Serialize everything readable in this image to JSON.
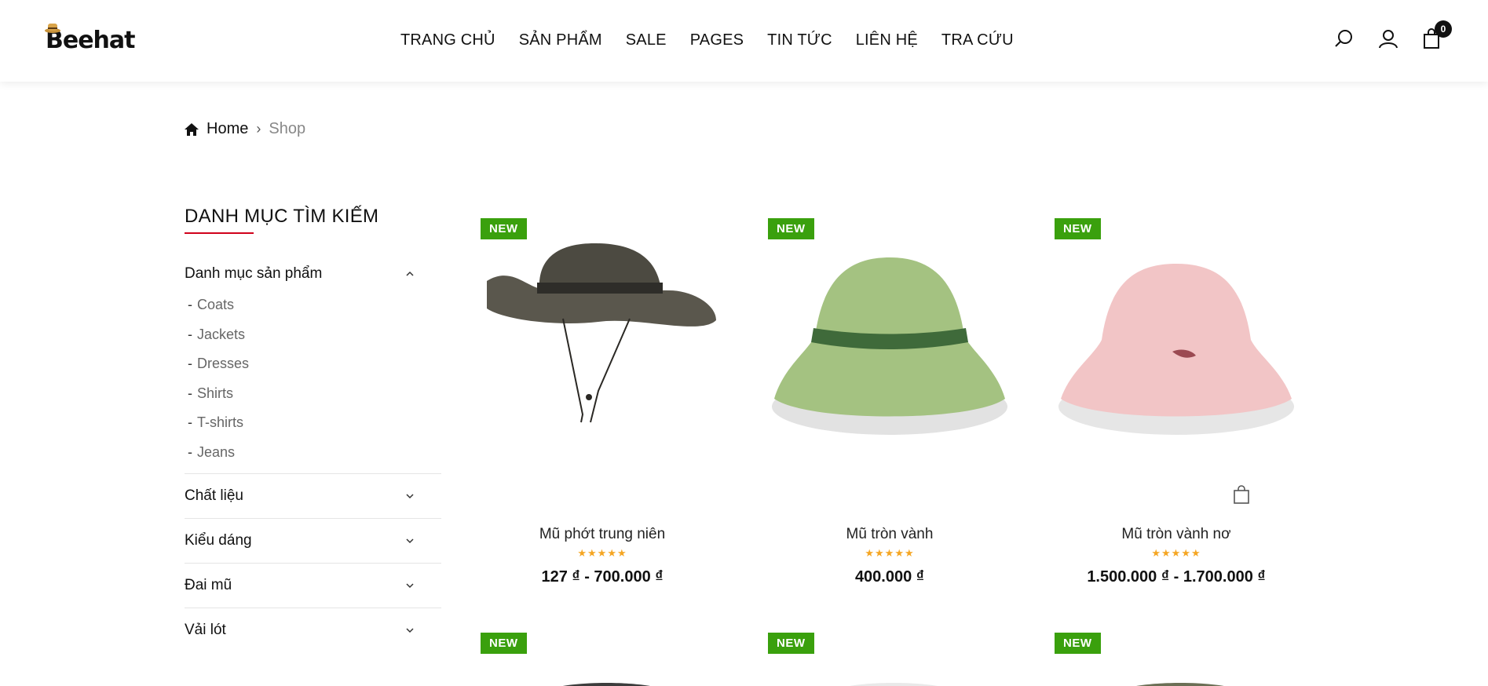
{
  "header": {
    "logo_text": "Beehat",
    "nav": [
      "TRANG CHỦ",
      "SẢN PHẨM",
      "SALE",
      "PAGES",
      "TIN TỨC",
      "LIÊN HỆ",
      "TRA CỨU"
    ],
    "cart_count": "0",
    "icons": [
      "search-icon",
      "user-icon",
      "shopping-bag-icon"
    ]
  },
  "breadcrumb": {
    "home": "Home",
    "current": "Shop"
  },
  "sidebar": {
    "title": "DANH MỤC TÌM KIẾM",
    "category_group": "Danh mục sản phẩm",
    "categories": [
      "Coats",
      "Jackets",
      "Dresses",
      "Shirts",
      "T-shirts",
      "Jeans"
    ],
    "groups": [
      "Chất liệu",
      "Kiểu dáng",
      "Đai mũ",
      "Vải lót"
    ]
  },
  "products": [
    {
      "badge": "NEW",
      "name": "Mũ phớt trung niên",
      "price": "127 ₫ - 700.000 ₫",
      "rating": 5
    },
    {
      "badge": "NEW",
      "name": "Mũ tròn vành",
      "price": "400.000 ₫",
      "rating": 5
    },
    {
      "badge": "NEW",
      "name": "Mũ tròn vành nơ",
      "price": "1.500.000 ₫ - 1.700.000 ₫",
      "rating": 5
    },
    {
      "badge": "NEW"
    },
    {
      "badge": "NEW"
    },
    {
      "badge": "NEW"
    }
  ],
  "colors": {
    "accent_red": "#d0021b",
    "badge_green": "#3aa00d",
    "star": "#f5a623"
  }
}
